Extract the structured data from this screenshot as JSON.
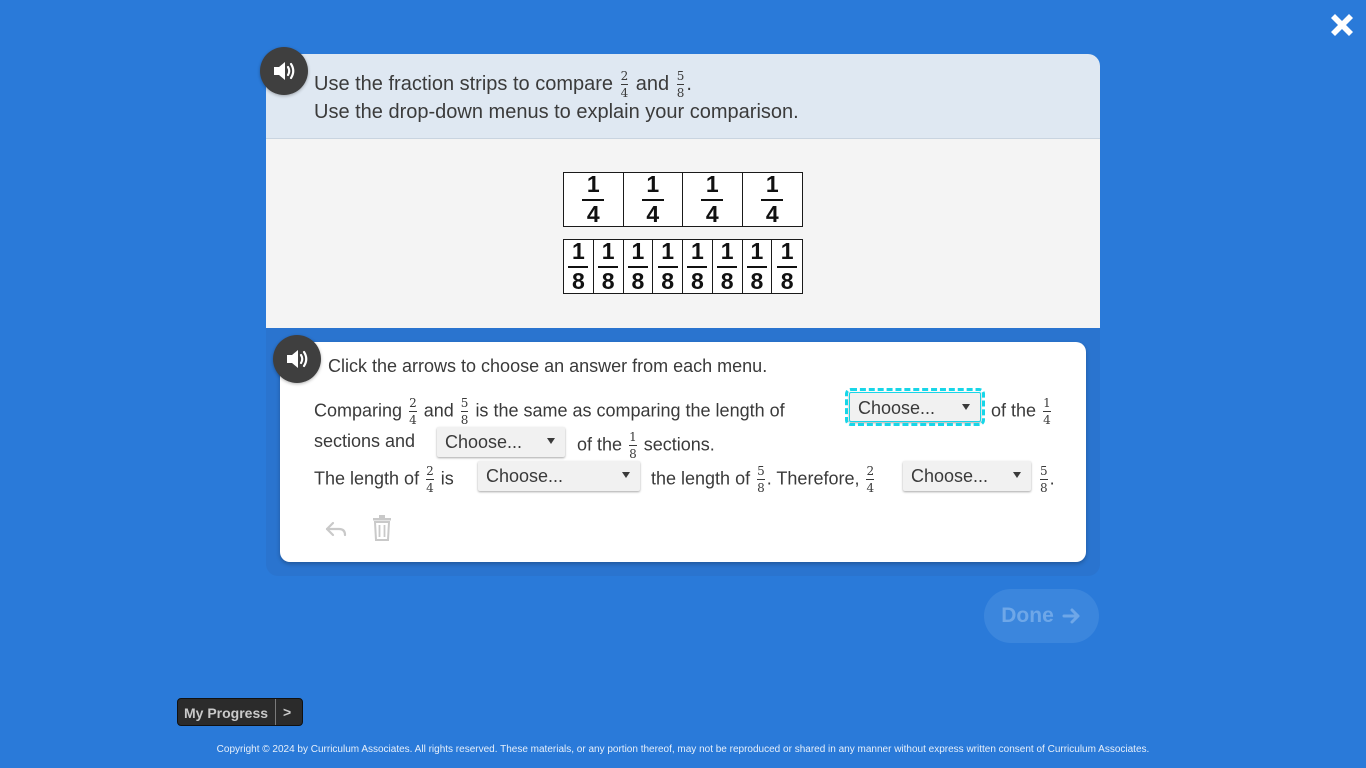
{
  "close": {
    "icon": "close-icon"
  },
  "prompt": {
    "line1_pre": "Use the fraction strips to compare",
    "line1_mid": "and",
    "line1_end": ".",
    "line2": "Use the drop-down menus to explain your comparison.",
    "frac_a": {
      "num": "2",
      "den": "4"
    },
    "frac_b": {
      "num": "5",
      "den": "8"
    }
  },
  "strips": {
    "quarters": {
      "num": "1",
      "den": "4"
    },
    "eighths": {
      "num": "1",
      "den": "8"
    }
  },
  "answer": {
    "instruction": "Click the arrows to choose an answer from each menu.",
    "row1_comparing": "Comparing",
    "row1_and": "and",
    "row1_mid": "is the same as comparing the length of",
    "row1_ofthe": "of the",
    "row2_sections_and": "sections and",
    "row2_ofthe": "of the",
    "row2_sections": "sections.",
    "row3_length_of": "The length of",
    "row3_is": "is",
    "row3_the_length_of": "the length of",
    "row3_therefore": ". Therefore,",
    "row3_end": ".",
    "frac_2_4": {
      "num": "2",
      "den": "4"
    },
    "frac_5_8": {
      "num": "5",
      "den": "8"
    },
    "frac_1_4": {
      "num": "1",
      "den": "4"
    },
    "frac_1_8": {
      "num": "1",
      "den": "8"
    },
    "dropdown_placeholder": "Choose..."
  },
  "tools": {
    "undo_icon": "undo-icon",
    "trash_icon": "trash-icon"
  },
  "done": {
    "label": "Done"
  },
  "progress": {
    "label": "My Progress",
    "arrow": ">"
  },
  "footer": {
    "copyright": "Copyright © 2024 by Curriculum Associates. All rights reserved. These materials, or any portion thereof, may not be reproduced or shared in any manner without express written consent of Curriculum Associates."
  },
  "colors": {
    "background": "#2a7ad9",
    "focus": "#17d6e8",
    "speaker": "#3f3f3f"
  }
}
